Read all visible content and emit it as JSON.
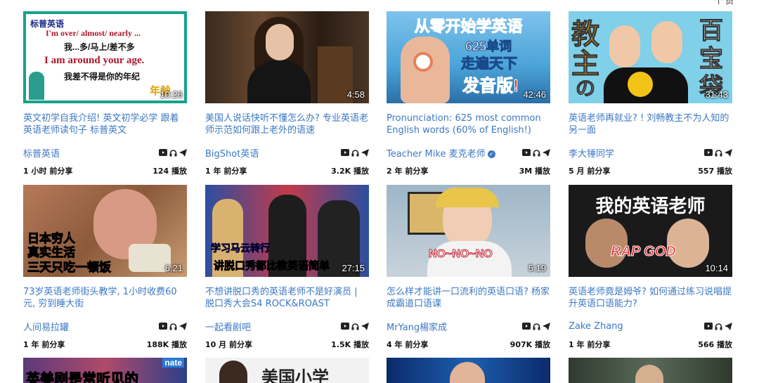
{
  "cards": [
    {
      "title": "英文初学自我介绍! 英文初学必学 跟着英语老师读句子 标普英文",
      "channel": "标普英语",
      "time": "1 小时 前分享",
      "views": "124 播放",
      "duration": "10:26",
      "thumb_lines": [
        "标普英语",
        "I'm over/ almost/ nearly ...",
        "我...多/马上/差不多",
        "I am around your age.",
        "我差不得是你的年纪",
        "年龄"
      ]
    },
    {
      "title": "美国人说话快听不懂怎么办? 专业英语老师示范如何跟上老外的语速",
      "channel": "BigShot英语",
      "time": "1 年 前分享",
      "views": "3.2K 播放",
      "duration": "4:58",
      "thumb_lines": []
    },
    {
      "title": "Pronunciation: 625 most common English words (60% of English!)",
      "channel": "Teacher Mike 麦克老师",
      "time": "2 年 前分享",
      "views": "3M 播放",
      "duration": "42:46",
      "thumb_lines": [
        "从零开始学英语",
        "625单词",
        "走遍天下",
        "发音版!"
      ]
    },
    {
      "title": "英语老师再就业? ! 刘畅教主不为人知的另一面",
      "channel": "李大锤同学",
      "time": "5 月 前分享",
      "views": "557 播放",
      "duration": "31:43",
      "thumb_lines": [
        "教",
        "主",
        "の",
        "百",
        "宝",
        "袋"
      ]
    },
    {
      "title": "73岁英语老师街头教学, 1小时收费60元, 穷到睡大街",
      "channel": "人间易拉罐",
      "time": "1 年 前分享",
      "views": "188K 播放",
      "duration": "6:21",
      "thumb_lines": [
        "日本穷人",
        "真实生活",
        "三天只吃一顿饭"
      ]
    },
    {
      "title": "不想讲脱口秀的英语老师不是好演员 | 脱口秀大会S4 ROCK&ROAST",
      "channel": "一起看剧吧",
      "time": "10 月 前分享",
      "views": "1.5K 播放",
      "duration": "27:15",
      "thumb_lines": [
        "学习马云转行",
        "讲脱口秀都比教英语简单"
      ]
    },
    {
      "title": "怎么样才能讲一口流利的英语口语? 杨家成霸道口语课",
      "channel": "MrYang楊家成",
      "time": "4 年 前分享",
      "views": "907K 播放",
      "duration": "5:19",
      "thumb_lines": [
        "NO~NO~NO"
      ]
    },
    {
      "title": "英语老师竟是姆爷? 如何通过练习说唱提升英语口语能力?",
      "channel": "Zake Zhang",
      "time": "1 年 前分享",
      "views": "566 播放",
      "duration": "10:14",
      "thumb_lines": [
        "我的英语老师",
        "RAP GOD"
      ]
    }
  ],
  "partial_row": {
    "lines": [
      "英美剧是常听见的",
      "nate",
      "美国小学"
    ]
  },
  "corner_text": "个 员"
}
